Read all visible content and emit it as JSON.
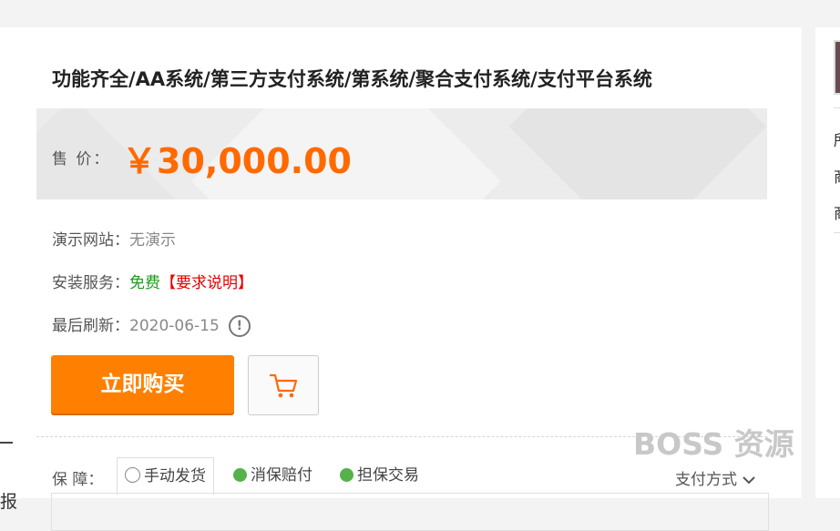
{
  "product": {
    "title": "功能齐全/AA系统/第三方支付系统/第系统/聚合支付系统/支付平台系统",
    "price_label": "售  价：",
    "price": "￥30,000.00"
  },
  "details": {
    "demo_label": "演示网站：",
    "demo_value": "无演示",
    "install_label": "安装服务：",
    "install_value": "免费",
    "install_note": "【要求说明】",
    "refresh_label": "最后刷新：",
    "refresh_value": "2020-06-15",
    "info_icon": "!"
  },
  "actions": {
    "buy_label": "立即购买",
    "cart_icon": "shopping-cart-icon"
  },
  "guarantee": {
    "label": "保  障：",
    "items": [
      "手动发货",
      "消保赔付",
      "担保交易"
    ],
    "pay_method": "支付方式"
  },
  "watermark": "BOSS 资源",
  "left_edge": {
    "char": "报"
  },
  "right_edge": {
    "chars": [
      "所",
      "商",
      "商"
    ]
  },
  "colors": {
    "price": "#ff6a00",
    "buy_button": "#ff8000",
    "free": "#1a9c1a",
    "note": "#e50000",
    "check_green": "#55b24a"
  }
}
